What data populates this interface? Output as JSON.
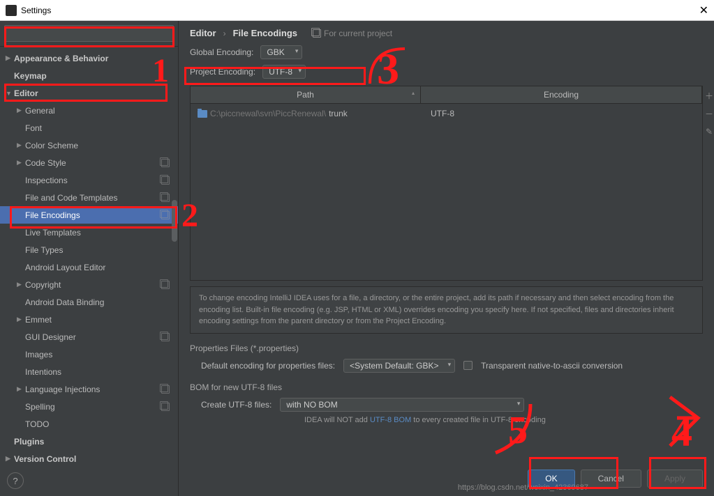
{
  "titlebar": {
    "title": "Settings"
  },
  "sidebar": {
    "items": [
      {
        "label": "Appearance & Behavior",
        "arrow": "▶",
        "bold": true,
        "indent": 0
      },
      {
        "label": "Keymap",
        "bold": true,
        "indent": 0
      },
      {
        "label": "Editor",
        "arrow": "▼",
        "bold": true,
        "indent": 0
      },
      {
        "label": "General",
        "arrow": "▶",
        "indent": 1
      },
      {
        "label": "Font",
        "indent": 1
      },
      {
        "label": "Color Scheme",
        "arrow": "▶",
        "indent": 1
      },
      {
        "label": "Code Style",
        "arrow": "▶",
        "indent": 1,
        "copy": true
      },
      {
        "label": "Inspections",
        "indent": 1,
        "copy": true
      },
      {
        "label": "File and Code Templates",
        "indent": 1,
        "copy": true
      },
      {
        "label": "File Encodings",
        "indent": 1,
        "copy": true,
        "selected": true
      },
      {
        "label": "Live Templates",
        "indent": 1
      },
      {
        "label": "File Types",
        "indent": 1
      },
      {
        "label": "Android Layout Editor",
        "indent": 1
      },
      {
        "label": "Copyright",
        "arrow": "▶",
        "indent": 1,
        "copy": true
      },
      {
        "label": "Android Data Binding",
        "indent": 1
      },
      {
        "label": "Emmet",
        "arrow": "▶",
        "indent": 1
      },
      {
        "label": "GUI Designer",
        "indent": 1,
        "copy": true
      },
      {
        "label": "Images",
        "indent": 1
      },
      {
        "label": "Intentions",
        "indent": 1
      },
      {
        "label": "Language Injections",
        "arrow": "▶",
        "indent": 1,
        "copy": true
      },
      {
        "label": "Spelling",
        "indent": 1,
        "copy": true
      },
      {
        "label": "TODO",
        "indent": 1
      },
      {
        "label": "Plugins",
        "bold": true,
        "indent": 0
      },
      {
        "label": "Version Control",
        "arrow": "▶",
        "bold": true,
        "indent": 0
      }
    ]
  },
  "breadcrumb": {
    "root": "Editor",
    "leaf": "File Encodings",
    "currentProject": "For current project"
  },
  "globalEncoding": {
    "label": "Global Encoding:",
    "value": "GBK"
  },
  "projectEncoding": {
    "label": "Project Encoding:",
    "value": "UTF-8"
  },
  "table": {
    "pathHeader": "Path",
    "encHeader": "Encoding",
    "rows": [
      {
        "pathDim": "C:\\piccnewal\\svn\\PiccRenewal\\",
        "pathName": "trunk",
        "encoding": "UTF-8"
      }
    ]
  },
  "explain": "To change encoding IntelliJ IDEA uses for a file, a directory, or the entire project, add its path if necessary and then select encoding from the encoding list. Built-in file encoding (e.g. JSP, HTML or XML) overrides encoding you specify here. If not specified, files and directories inherit encoding settings from the parent directory or from the Project Encoding.",
  "props": {
    "section": "Properties Files (*.properties)",
    "defaultLabel": "Default encoding for properties files:",
    "defaultValue": "<System Default: GBK>",
    "transparentLabel": "Transparent native-to-ascii conversion"
  },
  "bom": {
    "section": "BOM for new UTF-8 files",
    "createLabel": "Create UTF-8 files:",
    "createValue": "with NO BOM",
    "hintPrefix": "IDEA will NOT add ",
    "hintLink": "UTF-8 BOM",
    "hintSuffix": " to every created file in UTF-8 encoding"
  },
  "buttons": {
    "ok": "OK",
    "cancel": "Cancel",
    "apply": "Apply"
  },
  "help": "?",
  "watermark": "https://blog.csdn.net/weixin_42369687",
  "annotations": {
    "n1": "1",
    "n2": "2",
    "n3": "3",
    "n4": "4",
    "n5": "5"
  }
}
